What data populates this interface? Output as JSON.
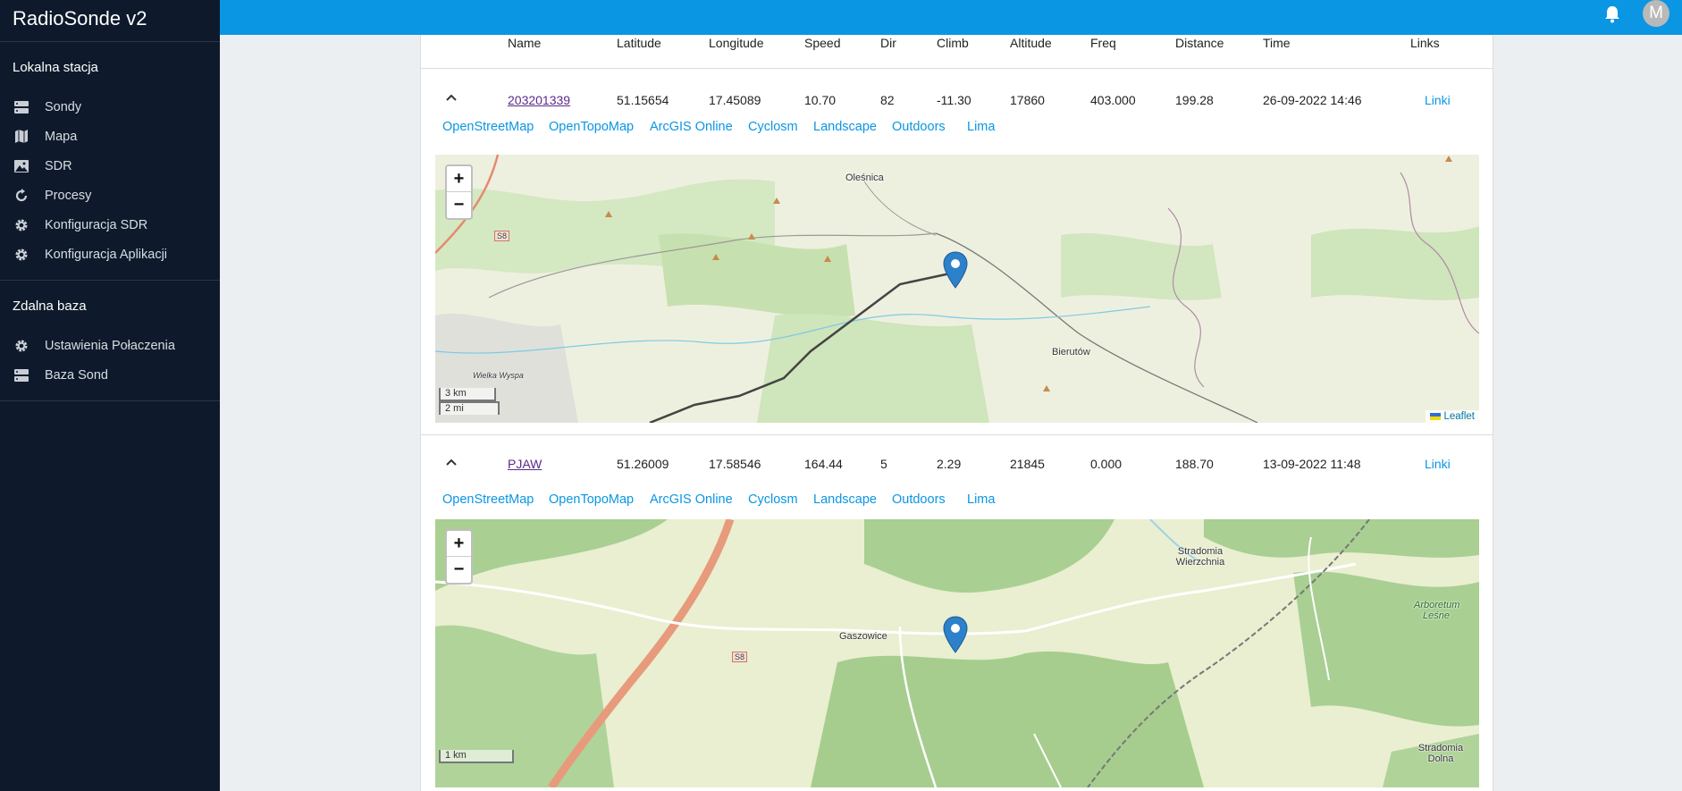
{
  "app": {
    "title": "RadioSonde v2",
    "avatar_letter": "M",
    "accent": "#0a96e3"
  },
  "sidebar": {
    "local_section": "Lokalna stacja",
    "local_items": [
      {
        "label": "Sondy",
        "icon": "server-icon"
      },
      {
        "label": "Mapa",
        "icon": "map-icon"
      },
      {
        "label": "SDR",
        "icon": "image-icon"
      },
      {
        "label": "Procesy",
        "icon": "refresh-icon"
      },
      {
        "label": "Konfiguracja SDR",
        "icon": "gear-icon"
      },
      {
        "label": "Konfiguracja Aplikacji",
        "icon": "gear-icon"
      }
    ],
    "remote_section": "Zdalna baza",
    "remote_items": [
      {
        "label": "Ustawienia Połaczenia",
        "icon": "gear-icon"
      },
      {
        "label": "Baza Sond",
        "icon": "server-icon"
      }
    ]
  },
  "table": {
    "headers": [
      "Name",
      "Latitude",
      "Longitude",
      "Speed",
      "Dir",
      "Climb",
      "Altitude",
      "Freq",
      "Distance",
      "Time",
      "Links"
    ],
    "map_links": [
      "OpenStreetMap",
      "OpenTopoMap",
      "ArcGIS Online",
      "Cyclosm",
      "Landscape",
      "Outdoors",
      "Lima"
    ],
    "rows": [
      {
        "name": "203201339",
        "latitude": "51.15654",
        "longitude": "17.45089",
        "speed": "10.70",
        "dir": "82",
        "climb": "-11.30",
        "altitude": "17860",
        "freq": "403.000",
        "distance": "199.28",
        "time": "26-09-2022 14:46",
        "links": "Linki",
        "map": {
          "zoom_in": "+",
          "zoom_out": "−",
          "scale_km": "3 km",
          "scale_mi": "2 mi",
          "attribution": "Leaflet",
          "places": [
            "Oleśnica",
            "Bierutów",
            "Wielka Wyspa",
            "S8"
          ]
        }
      },
      {
        "name": "PJAW",
        "latitude": "51.26009",
        "longitude": "17.58546",
        "speed": "164.44",
        "dir": "5",
        "climb": "2.29",
        "altitude": "21845",
        "freq": "0.000",
        "distance": "188.70",
        "time": "13-09-2022 11:48",
        "links": "Linki",
        "map": {
          "zoom_in": "+",
          "zoom_out": "−",
          "scale_km": "1 km",
          "places": [
            "Gaszowice",
            "Stradomia Wierzchnia",
            "Arboretum Leśne",
            "Stradomia Dolna",
            "S8"
          ]
        }
      }
    ]
  }
}
